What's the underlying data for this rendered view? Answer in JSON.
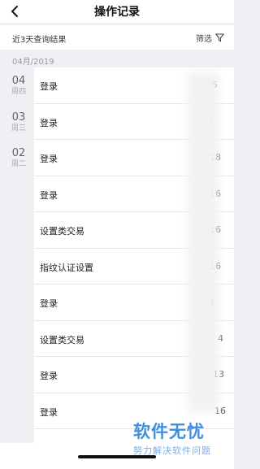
{
  "header": {
    "title": "操作记录",
    "back_icon": "chevron-left-icon"
  },
  "filter_bar": {
    "summary": "近3天查询结果",
    "filter_label": "筛选",
    "filter_icon": "funnel-icon"
  },
  "month": "04月/2019",
  "dates": [
    {
      "day": "04",
      "weekday": "周四"
    },
    {
      "day": "03",
      "weekday": "周三"
    },
    {
      "day": "02",
      "weekday": "周二"
    }
  ],
  "records": [
    {
      "label": "登录",
      "time": "05"
    },
    {
      "label": "登录",
      "time": "1  2"
    },
    {
      "label": "登录",
      "time": "18"
    },
    {
      "label": "登录",
      "time": "16"
    },
    {
      "label": "设置类交易",
      "time": "16"
    },
    {
      "label": "指纹认证设置",
      "time": "16"
    },
    {
      "label": "登录",
      "time": "1  8"
    },
    {
      "label": "设置类交易",
      "time": "4"
    },
    {
      "label": "登录",
      "time": "13"
    },
    {
      "label": "登录",
      "time": "16"
    }
  ],
  "watermark": {
    "title": "软件无忧",
    "subtitle": "努力解决软件问题"
  }
}
